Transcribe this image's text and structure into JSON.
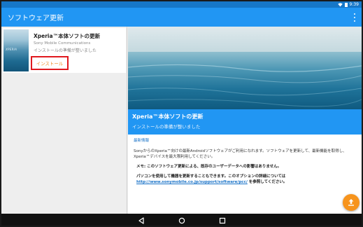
{
  "status_bar": {
    "time": "9:39",
    "wifi_icon": "wifi-icon",
    "battery_icon": "battery-icon"
  },
  "app_bar": {
    "title": "ソフトウェア更新",
    "overflow_icon": "more-vert-icon"
  },
  "update_card": {
    "title": "Xperia™本体ソフトの更新",
    "publisher": "Sony Mobile Communications",
    "status": "インストールの準備が整いました",
    "thumbnail_text": "XPERIA",
    "install_label": "インストール"
  },
  "detail": {
    "hero_title": "Xperia™本体ソフトの更新",
    "hero_subtitle": "インストールの準備が整いました",
    "section_label": "最新情報",
    "body_line1": "SonyからのXperia™向けの最新Androidソフトウェアがご利用になれます。ソフトウェアを更新して、最新機能を取得し、",
    "body_line2": "Xperia™デバイスを最大限利用してください。",
    "note1": "メモ: このソフトウェア更新による、既存のユーザーデータへの影響はありません。",
    "note2_prefix": "パソコンを使用して機器を更新することもできます。このオプションの詳細については",
    "note2_link": "http://www.sonymobile.co.jp/support/software/pcc/",
    "note2_suffix": "を参照してください。"
  },
  "fab": {
    "icon": "upload-icon"
  },
  "nav_bar": {
    "back_icon": "back-icon",
    "home_icon": "home-icon",
    "recents_icon": "recents-icon"
  },
  "colors": {
    "accent": "#2196f3",
    "status_bar": "#1677c8",
    "fab": "#f7941d",
    "highlight_box": "#e0191e",
    "install_text": "#f08a24"
  }
}
